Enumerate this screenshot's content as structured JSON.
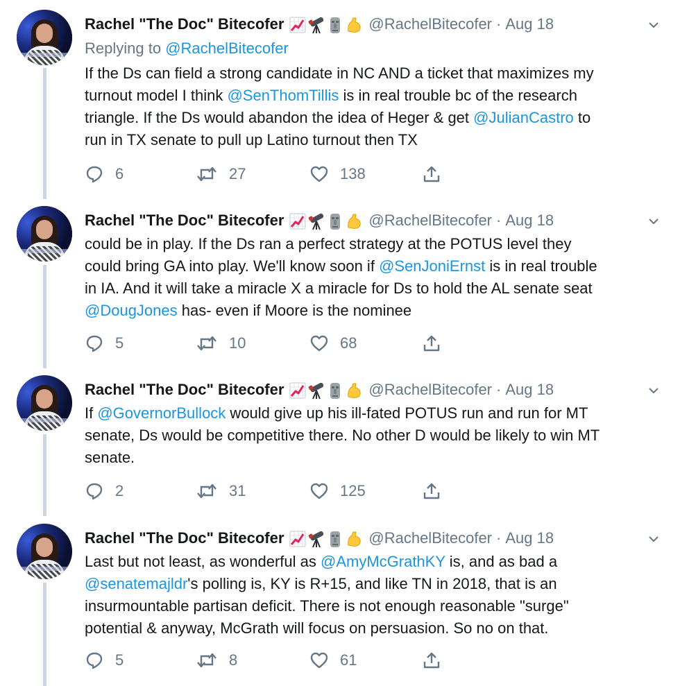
{
  "author": {
    "name": "Rachel \"The Doc\" Bitecofer",
    "handle": "@RachelBitecofer",
    "date_sep": "·",
    "date": "Aug 18",
    "emoji_icons": [
      "chart-increasing-icon",
      "telescope-icon",
      "moai-icon",
      "flexed-biceps-icon"
    ]
  },
  "tweets": [
    {
      "replying_prefix": "Replying to ",
      "replying_handle": "@RachelBitecofer",
      "lines": [
        [
          {
            "t": "If the Ds can field a strong candidate in NC AND a ticket that maximizes my"
          }
        ],
        [
          {
            "t": "turnout model I think "
          },
          {
            "t": "@SenThomTillis",
            "link": true
          },
          {
            "t": " is in real trouble bc of the research"
          }
        ],
        [
          {
            "t": "triangle. If the Ds would abandon the idea of Heger & get "
          },
          {
            "t": "@JulianCastro",
            "link": true
          },
          {
            "t": " to"
          }
        ],
        [
          {
            "t": "run in TX senate to pull up Latino turnout then TX"
          }
        ]
      ],
      "replies": "6",
      "retweets": "27",
      "likes": "138"
    },
    {
      "lines": [
        [
          {
            "t": "could be in play. If the Ds ran a perfect strategy at the POTUS level they"
          }
        ],
        [
          {
            "t": "could bring GA into play. We'll know soon if "
          },
          {
            "t": "@SenJoniErnst",
            "link": true
          },
          {
            "t": " is in real trouble"
          }
        ],
        [
          {
            "t": "in IA. And it will take a miracle X a miracle for Ds to hold the AL senate seat"
          }
        ],
        [
          {
            "t": "@DougJones",
            "link": true
          },
          {
            "t": " has- even if Moore is the nominee"
          }
        ]
      ],
      "replies": "5",
      "retweets": "10",
      "likes": "68"
    },
    {
      "lines": [
        [
          {
            "t": "If "
          },
          {
            "t": "@GovernorBullock",
            "link": true
          },
          {
            "t": " would give up his ill-fated POTUS run and run for MT"
          }
        ],
        [
          {
            "t": "senate, Ds would be competitive there. No other D would be likely to win MT"
          }
        ],
        [
          {
            "t": "senate."
          }
        ]
      ],
      "replies": "2",
      "retweets": "31",
      "likes": "125"
    },
    {
      "lines": [
        [
          {
            "t": "Last but not least, as wonderful as "
          },
          {
            "t": "@AmyMcGrathKY",
            "link": true
          },
          {
            "t": " is, and as bad a"
          }
        ],
        [
          {
            "t": "@senatemajldr",
            "link": true
          },
          {
            "t": "'s polling is, KY is R+15, and like TN in 2018, that is an"
          }
        ],
        [
          {
            "t": "insurmountable partisan deficit. There is not enough reasonable \"surge\""
          }
        ],
        [
          {
            "t": "potential & anyway, McGrath will focus on persuasion. So no on that."
          }
        ]
      ],
      "replies": "5",
      "retweets": "8",
      "likes": "61"
    }
  ],
  "colors": {
    "link": "#1b95e0",
    "muted": "#657786",
    "text": "#14171a",
    "thread_line": "#cdd6dd"
  },
  "icons": {
    "reply": "reply-icon",
    "retweet": "retweet-icon",
    "like": "heart-icon",
    "share": "share-icon",
    "menu": "chevron-down-icon"
  }
}
